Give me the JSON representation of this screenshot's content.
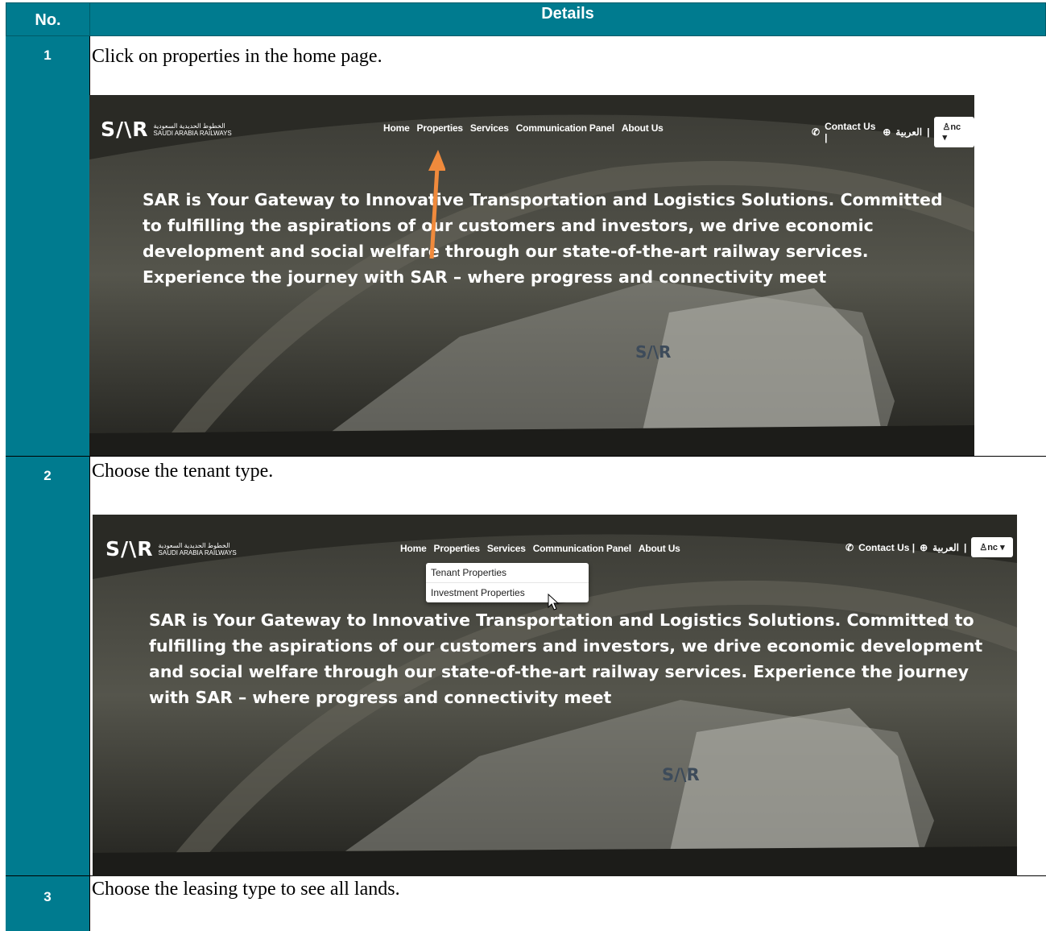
{
  "header": {
    "no": "No.",
    "details": "Details"
  },
  "site": {
    "logo_mark": "S/\\R",
    "logo_ar": "الخطوط الحديدية السعودية",
    "logo_en": "SAUDI ARABIA RAILWAYS",
    "menu": [
      "Home",
      "Properties",
      "Services",
      "Communication Panel",
      "About Us"
    ],
    "contact": "Contact Us |",
    "lang": "العربية",
    "user": "nc",
    "hero": "SAR is Your Gateway to Innovative Transportation and Logistics Solutions. Committed to fulfilling the aspirations of our customers and investors, we drive economic development and social welfare through our state-of-the-art railway services. Experience the journey with SAR – where progress and connectivity meet",
    "train_logo": "S/\\R"
  },
  "dropdown": [
    "Tenant Properties",
    "Investment Properties"
  ],
  "steps": [
    {
      "no": "1",
      "text": "Click on properties in the home page."
    },
    {
      "no": "2",
      "text": "Choose the tenant type."
    },
    {
      "no": "3",
      "text": "Choose the leasing type to see all lands."
    }
  ],
  "colors": {
    "header_bg": "#007b8f",
    "arrow": "#f08a3c"
  }
}
